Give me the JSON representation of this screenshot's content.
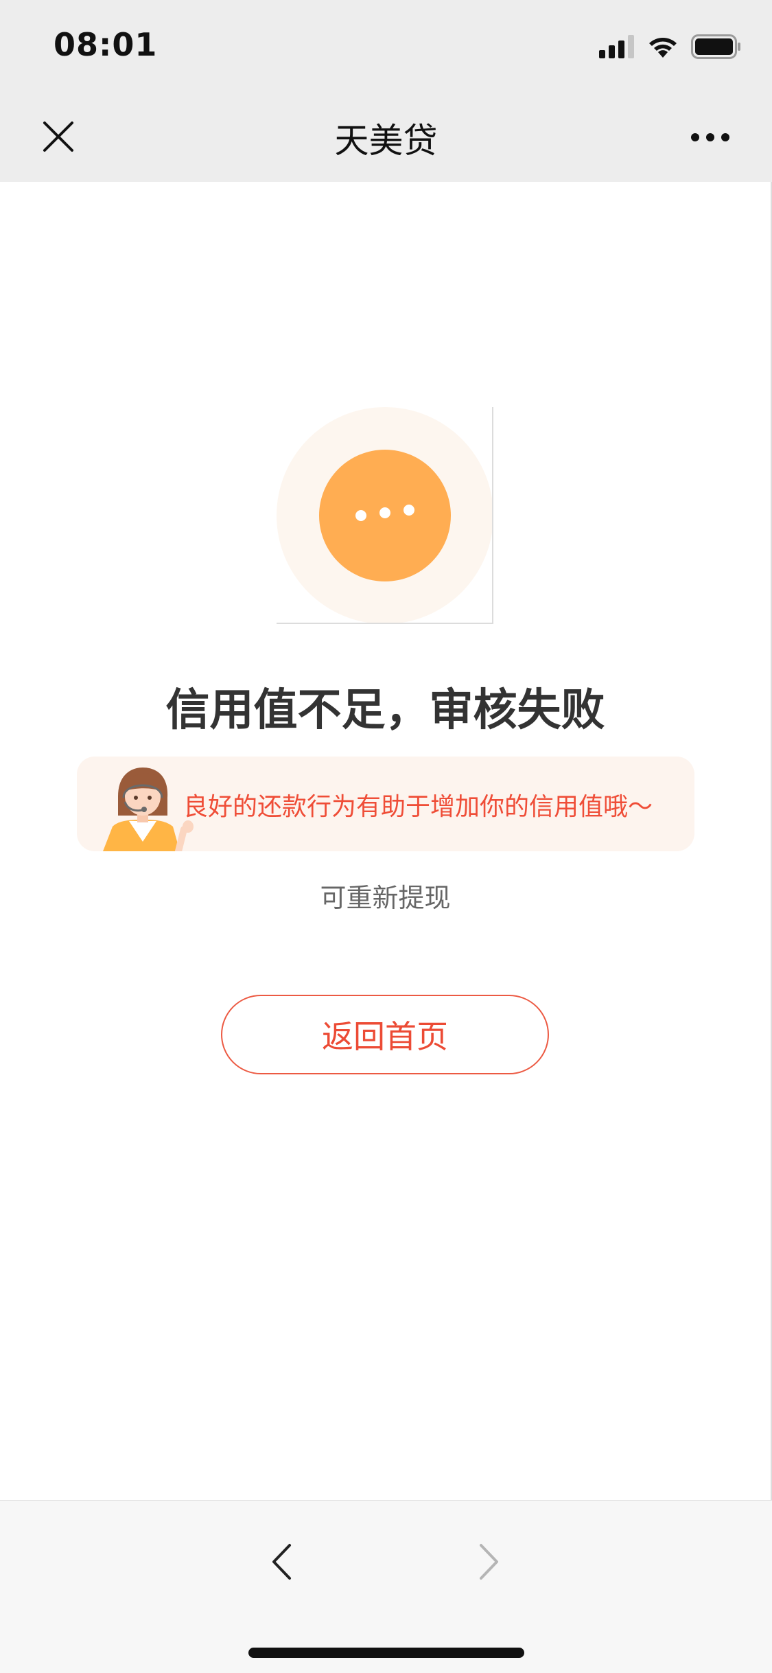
{
  "status_bar": {
    "time": "08:01",
    "icons": [
      "cellular-signal-icon",
      "wifi-icon",
      "battery-icon"
    ]
  },
  "nav_bar": {
    "title": "天美贷",
    "close_icon": "close-icon",
    "more_icon": "more-icon"
  },
  "result": {
    "icon": "pending-dots-icon",
    "title": "信用值不足，审核失败",
    "tip": "良好的还款行为有助于增加你的信用值哦～",
    "subtitle": "可重新提现",
    "button_label": "返回首页"
  },
  "bottom_nav": {
    "back_icon": "chevron-left-icon",
    "forward_icon": "chevron-right-icon"
  },
  "colors": {
    "accent": "#ffad52",
    "halo": "#fdf6ef",
    "alert_text": "#ef4d37",
    "button_border": "#ec5a43",
    "banner_bg": "#fdf4ee"
  }
}
